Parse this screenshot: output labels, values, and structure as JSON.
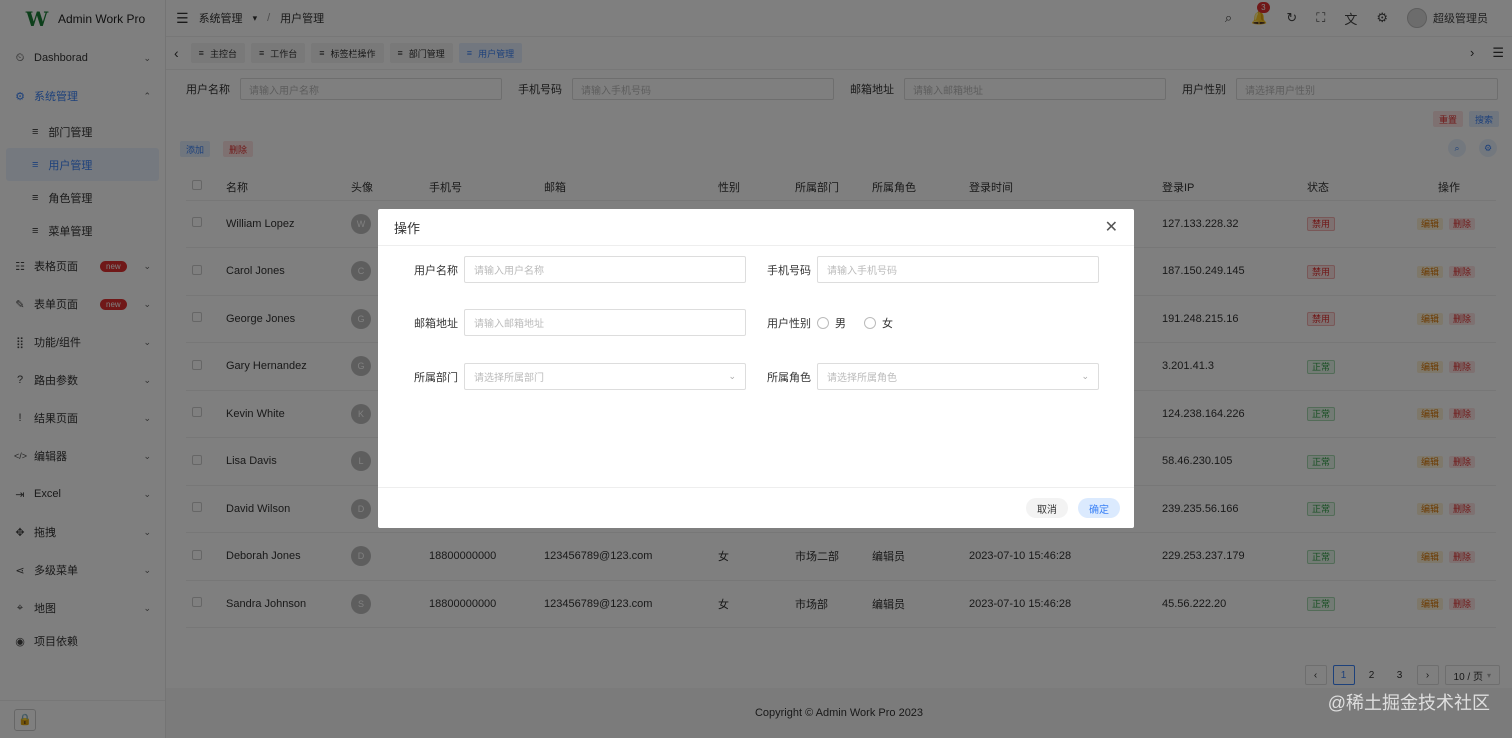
{
  "app": {
    "name": "Admin Work Pro",
    "logo": "W"
  },
  "sidebar": {
    "items": [
      {
        "icon": "⏲",
        "label": "Dashborad",
        "chev": "⌄"
      },
      {
        "icon": "⚙",
        "label": "系统管理",
        "chev": "⌃"
      },
      {
        "icon": "☷",
        "label": "表格页面",
        "badge": "new",
        "chev": "⌄"
      },
      {
        "icon": "✎",
        "label": "表单页面",
        "badge": "new",
        "chev": "⌄"
      },
      {
        "icon": "⣿",
        "label": "功能/组件",
        "chev": "⌄"
      },
      {
        "icon": "?",
        "label": "路由参数",
        "chev": "⌄"
      },
      {
        "icon": "!",
        "label": "结果页面",
        "chev": "⌄"
      },
      {
        "icon": "</>",
        "label": "编辑器",
        "chev": "⌄"
      },
      {
        "icon": "⇥",
        "label": "Excel",
        "chev": "⌄"
      },
      {
        "icon": "✥",
        "label": "拖拽",
        "chev": "⌄"
      },
      {
        "icon": "⋖",
        "label": "多级菜单",
        "chev": "⌄"
      },
      {
        "icon": "⌖",
        "label": "地图",
        "chev": "⌄"
      },
      {
        "icon": "◉",
        "label": "项目依赖"
      }
    ],
    "subitems": [
      "部门管理",
      "用户管理",
      "角色管理",
      "菜单管理"
    ]
  },
  "topbar": {
    "crumb1": "系统管理",
    "sep": "/",
    "crumb2": "用户管理",
    "notif_count": "3",
    "user": "超级管理员"
  },
  "tabs": [
    "主控台",
    "工作台",
    "标签栏操作",
    "部门管理",
    "用户管理"
  ],
  "search": {
    "name_label": "用户名称",
    "name_ph": "请输入用户名称",
    "phone_label": "手机号码",
    "phone_ph": "请输入手机号码",
    "email_label": "邮箱地址",
    "email_ph": "请输入邮箱地址",
    "gender_label": "用户性别",
    "gender_ph": "请选择用户性别",
    "reset": "重置",
    "search": "搜索"
  },
  "actions": {
    "add": "添加",
    "delete": "删除"
  },
  "table": {
    "headers": [
      "名称",
      "头像",
      "手机号",
      "邮箱",
      "性别",
      "所属部门",
      "所属角色",
      "登录时间",
      "登录IP",
      "状态",
      "操作"
    ],
    "edit": "编辑",
    "del": "删除",
    "rows": [
      {
        "name": "William Lopez",
        "av": "W",
        "phone": "",
        "email": "",
        "gender": "",
        "dept": "",
        "role": "",
        "time": "",
        "ip": "127.133.228.32",
        "status": "禁用",
        "on": false
      },
      {
        "name": "Carol Jones",
        "av": "C",
        "phone": "",
        "email": "",
        "gender": "",
        "dept": "",
        "role": "",
        "time": "",
        "ip": "187.150.249.145",
        "status": "禁用",
        "on": false
      },
      {
        "name": "George Jones",
        "av": "G",
        "phone": "",
        "email": "",
        "gender": "",
        "dept": "",
        "role": "",
        "time": "",
        "ip": "191.248.215.16",
        "status": "禁用",
        "on": false
      },
      {
        "name": "Gary Hernandez",
        "av": "G",
        "phone": "",
        "email": "",
        "gender": "",
        "dept": "",
        "role": "",
        "time": "",
        "ip": "3.201.41.3",
        "status": "正常",
        "on": true
      },
      {
        "name": "Kevin White",
        "av": "K",
        "phone": "",
        "email": "",
        "gender": "",
        "dept": "",
        "role": "",
        "time": "",
        "ip": "124.238.164.226",
        "status": "正常",
        "on": true
      },
      {
        "name": "Lisa Davis",
        "av": "L",
        "phone": "",
        "email": "",
        "gender": "",
        "dept": "",
        "role": "",
        "time": "",
        "ip": "58.46.230.105",
        "status": "正常",
        "on": true
      },
      {
        "name": "David Wilson",
        "av": "D",
        "phone": "",
        "email": "",
        "gender": "",
        "dept": "",
        "role": "",
        "time": "",
        "ip": "239.235.56.166",
        "status": "正常",
        "on": true
      },
      {
        "name": "Deborah Jones",
        "av": "D",
        "phone": "18800000000",
        "email": "123456789@123.com",
        "gender": "女",
        "dept": "市场二部",
        "role": "编辑员",
        "time": "2023-07-10 15:46:28",
        "ip": "229.253.237.179",
        "status": "正常",
        "on": true
      },
      {
        "name": "Sandra Johnson",
        "av": "S",
        "phone": "18800000000",
        "email": "123456789@123.com",
        "gender": "女",
        "dept": "市场部",
        "role": "编辑员",
        "time": "2023-07-10 15:46:28",
        "ip": "45.56.222.20",
        "status": "正常",
        "on": true
      }
    ]
  },
  "pager": {
    "pages": [
      "1",
      "2",
      "3"
    ],
    "size": "10 / 页"
  },
  "footer": "Copyright © Admin Work Pro 2023",
  "modal": {
    "title": "操作",
    "name_label": "用户名称",
    "name_ph": "请输入用户名称",
    "phone_label": "手机号码",
    "phone_ph": "请输入手机号码",
    "email_label": "邮箱地址",
    "email_ph": "请输入邮箱地址",
    "gender_label": "用户性别",
    "male": "男",
    "female": "女",
    "dept_label": "所属部门",
    "dept_ph": "请选择所属部门",
    "role_label": "所属角色",
    "role_ph": "请选择所属角色",
    "cancel": "取消",
    "ok": "确定"
  },
  "watermark": "@稀土掘金技术社区"
}
